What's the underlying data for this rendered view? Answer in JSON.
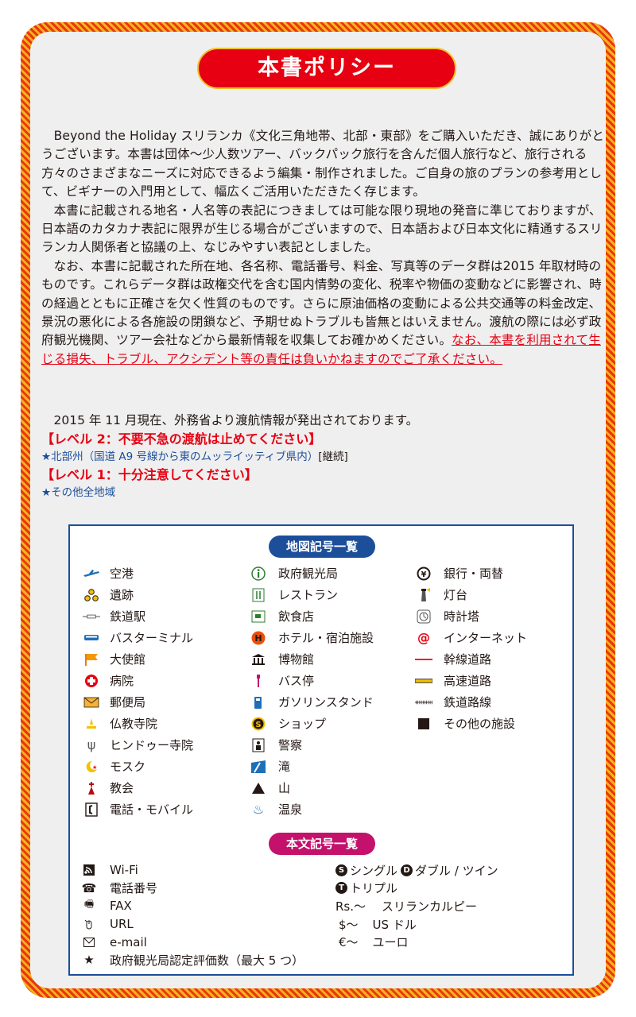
{
  "title": "本書ポリシー",
  "paragraphs": [
    "Beyond the Holiday スリランカ《文化三角地帯、北部・東部》をご購入いただき、誠にありがとうございます。本書は団体〜少人数ツアー、バックパック旅行を含んだ個人旅行など、旅行される方々のさまざまなニーズに対応できるよう編集・制作されました。ご自身の旅のプランの参考用として、ビギナーの入門用として、幅広くご活用いただきたく存じます。",
    "本書に記載される地名・人名等の表記につきましては可能な限り現地の発音に準じておりますが、日本語のカタカナ表記に限界が生じる場合がございますので、日本語および日本文化に精通するスリランカ人関係者と協議の上、なじみやすい表記としました。"
  ],
  "paragraph3_main": "なお、本書に記載された所在地、各名称、電話番号、料金、写真等のデータ群は2015 年取材時のものです。これらデータ群は政権交代を含む国内情勢の変化、税率や物価の変動などに影響され、時の経過とともに正確さを欠く性質のものです。さらに原油価格の変動による公共交通等の料金改定、景況の悪化による各施設の閉鎖など、予期せぬトラブルも皆無とはいえません。渡航の際には必ず政府観光機関、ツアー会社などから最新情報を収集してお確かめください。",
  "paragraph3_red": "なお、本書を利用されて生じる損失、トラブル、アクシデント等の責任は負いかねますのでご了承ください。",
  "notice": {
    "intro": "2015 年 11 月現在、外務省より渡航情報が発出されております。",
    "level2": "【レベル 2：不要不急の渡航は止めてください】",
    "level2_area": "★北部州（国道 A9 号線から東のムッライッティブ県内）",
    "level2_cont": "[継続]",
    "level1": "【レベル 1：十分注意してください】",
    "level1_area": "★その他全地域"
  },
  "legend": {
    "map_title": "地図記号一覧",
    "text_title": "本文記号一覧",
    "col1": [
      {
        "icon": "airport-icon",
        "label": "空港"
      },
      {
        "icon": "ruins-icon",
        "label": "遺跡"
      },
      {
        "icon": "train-station-icon",
        "label": "鉄道駅"
      },
      {
        "icon": "bus-terminal-icon",
        "label": "バスターミナル"
      },
      {
        "icon": "embassy-flag-icon",
        "label": "大使館"
      },
      {
        "icon": "hospital-icon",
        "label": "病院"
      },
      {
        "icon": "post-office-icon",
        "label": "郵便局"
      },
      {
        "icon": "buddhist-temple-icon",
        "label": "仏教寺院"
      },
      {
        "icon": "hindu-temple-icon",
        "label": "ヒンドゥー寺院"
      },
      {
        "icon": "mosque-icon",
        "label": "モスク"
      },
      {
        "icon": "church-icon",
        "label": "教会"
      },
      {
        "icon": "phone-mobile-icon",
        "label": "電話・モバイル"
      }
    ],
    "col2": [
      {
        "icon": "tourist-info-icon",
        "label": "政府観光局"
      },
      {
        "icon": "restaurant-icon",
        "label": "レストラン"
      },
      {
        "icon": "eatery-icon",
        "label": "飲食店"
      },
      {
        "icon": "hotel-icon",
        "label": "ホテル・宿泊施設"
      },
      {
        "icon": "museum-icon",
        "label": "博物館"
      },
      {
        "icon": "bus-stop-icon",
        "label": "バス停"
      },
      {
        "icon": "gas-station-icon",
        "label": "ガソリンスタンド"
      },
      {
        "icon": "shop-icon",
        "label": "ショップ"
      },
      {
        "icon": "police-icon",
        "label": "警察"
      },
      {
        "icon": "waterfall-icon",
        "label": "滝"
      },
      {
        "icon": "mountain-icon",
        "label": "山"
      },
      {
        "icon": "hot-spring-icon",
        "label": "温泉"
      }
    ],
    "col3": [
      {
        "icon": "bank-exchange-icon",
        "label": "銀行・両替"
      },
      {
        "icon": "lighthouse-icon",
        "label": "灯台"
      },
      {
        "icon": "clock-tower-icon",
        "label": "時計塔"
      },
      {
        "icon": "internet-icon",
        "label": "インターネット"
      },
      {
        "icon": "main-road-icon",
        "label": "幹線道路"
      },
      {
        "icon": "highway-icon",
        "label": "高速道路"
      },
      {
        "icon": "railway-icon",
        "label": "鉄道路線"
      },
      {
        "icon": "other-facility-icon",
        "label": "その他の施設"
      }
    ],
    "text_col1": [
      {
        "icon": "wifi-icon",
        "label": "Wi-Fi"
      },
      {
        "icon": "telephone-icon",
        "label": "電話番号"
      },
      {
        "icon": "fax-icon",
        "label": "FAX"
      },
      {
        "icon": "url-icon",
        "label": "URL"
      },
      {
        "icon": "email-icon",
        "label": "e-mail"
      },
      {
        "icon": "star-icon",
        "label": "政府観光局認定評価数（最大 5 つ）"
      }
    ],
    "room_single": "シングル",
    "room_double": "ダブル / ツイン",
    "room_triple": "トリプル",
    "currency": [
      {
        "sym": "Rs.〜",
        "label": "スリランカルピー"
      },
      {
        "sym": "$〜",
        "label": "US ドル"
      },
      {
        "sym": "€〜",
        "label": "ユーロ"
      }
    ]
  }
}
